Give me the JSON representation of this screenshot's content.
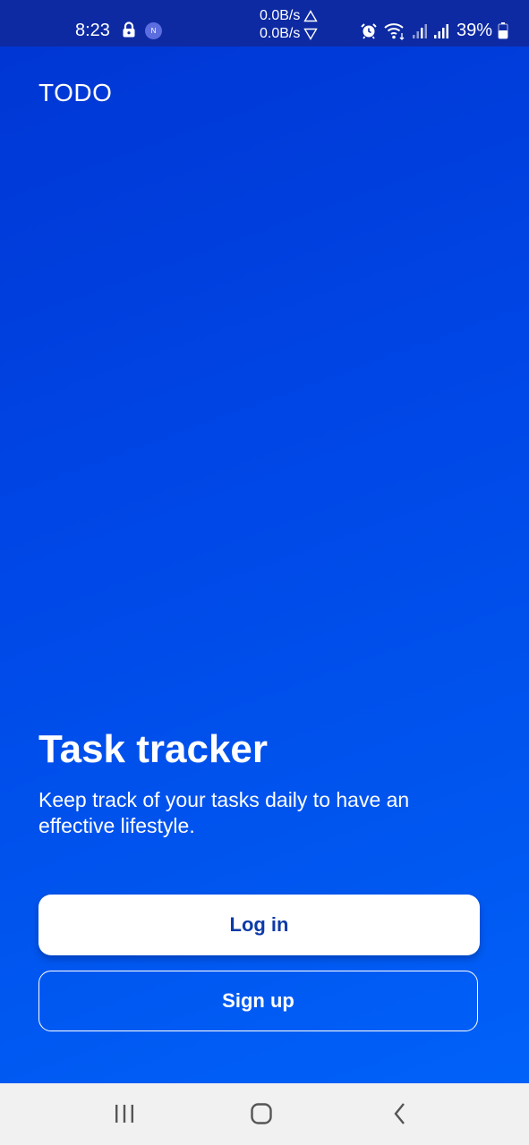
{
  "status_bar": {
    "time": "8:23",
    "notification_badge": "N",
    "upload_speed": "0.0B/s",
    "download_speed": "0.0B/s",
    "battery_percent": "39%",
    "icons": [
      "lock-icon",
      "notification-icon",
      "upload-arrow-icon",
      "download-arrow-icon",
      "alarm-icon",
      "wifi-icon",
      "signal-icon",
      "signal-icon",
      "battery-icon"
    ]
  },
  "app": {
    "title": "TODO"
  },
  "hero": {
    "title": "Task tracker",
    "subtitle": "Keep track of your tasks daily to have an effective lifestyle."
  },
  "actions": {
    "login_label": "Log in",
    "signup_label": "Sign up"
  },
  "nav_bar": {
    "icons": [
      "recent-apps-icon",
      "home-icon",
      "back-icon"
    ]
  },
  "colors": {
    "status_bar_bg": "#0d2aa3",
    "gradient_top": "#0035d2",
    "gradient_bottom": "#0064fb",
    "login_text": "#0d3aa8",
    "nav_bar_bg": "#f1f1f1"
  }
}
